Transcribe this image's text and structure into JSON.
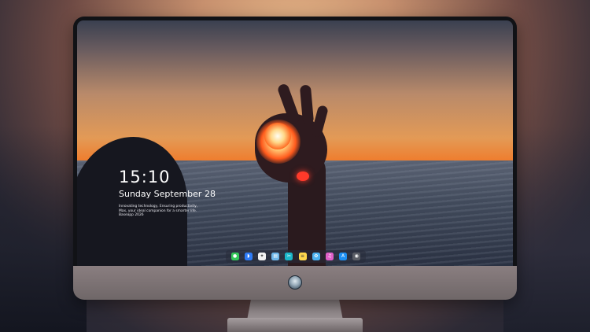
{
  "lock_screen": {
    "time": "15:10",
    "date": "Sunday September 28",
    "tagline": "Innovating technology, Ensuring productivity, Max, your ideal companion for a smarter life. Baseapp 2026"
  },
  "dock": {
    "items": [
      {
        "icon": "messages-icon",
        "color": "#34c759",
        "glyph": "●"
      },
      {
        "icon": "finder-icon",
        "color": "#2f7cf6",
        "glyph": "◗"
      },
      {
        "icon": "safari-icon",
        "color": "#f2f2f2",
        "glyph": "✦"
      },
      {
        "icon": "preview-icon",
        "color": "#6fb6e8",
        "glyph": "▤"
      },
      {
        "icon": "imovie-icon",
        "color": "#1bb6c9",
        "glyph": "✂"
      },
      {
        "icon": "notes-icon",
        "color": "#ffd84d",
        "glyph": "≡"
      },
      {
        "icon": "photos-icon",
        "color": "#4cb1f0",
        "glyph": "✿"
      },
      {
        "icon": "itunes-icon",
        "color": "#e060c8",
        "glyph": "♫"
      },
      {
        "icon": "app-store-icon",
        "color": "#1d8ff2",
        "glyph": "A"
      },
      {
        "icon": "camera-icon",
        "color": "#5b5e66",
        "glyph": "◉"
      }
    ]
  },
  "colors": {
    "monitor_bezel": "#111216",
    "chin": "#7d7375",
    "sunset_orange": "#f07a2a"
  }
}
